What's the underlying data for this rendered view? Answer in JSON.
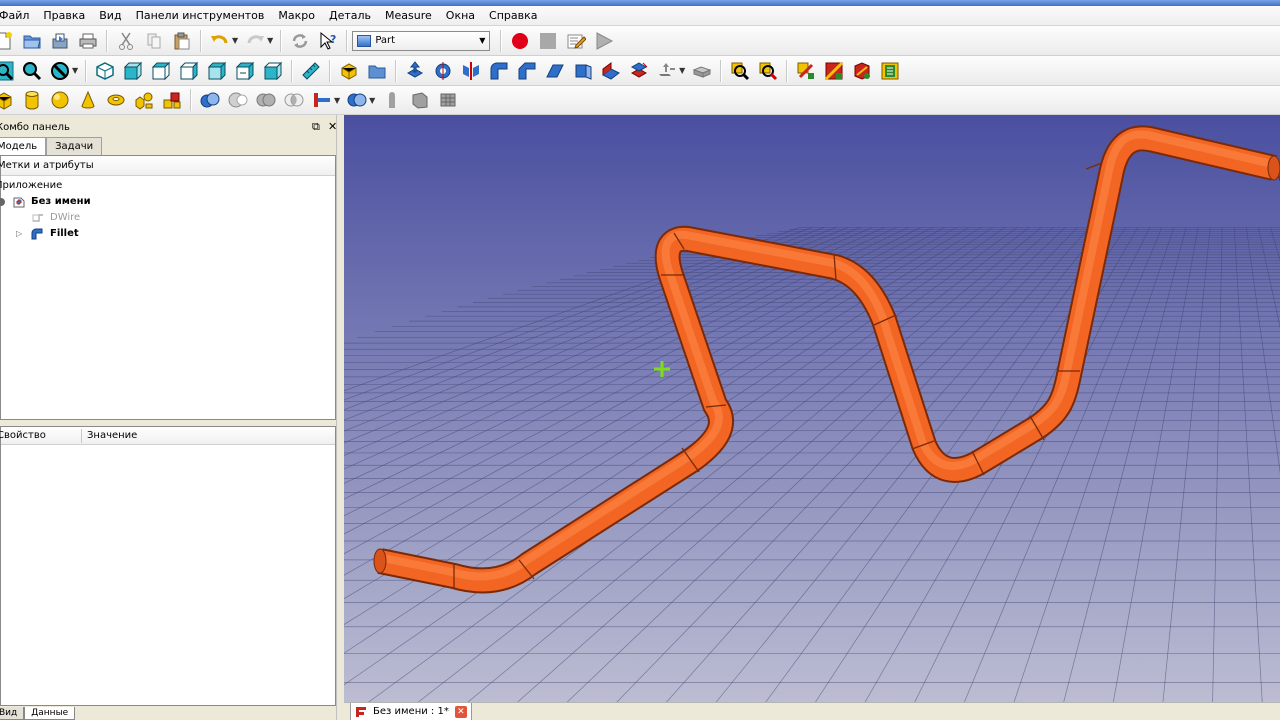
{
  "menu": [
    "Файл",
    "Правка",
    "Вид",
    "Панели инструментов",
    "Макро",
    "Деталь",
    "Measure",
    "Окна",
    "Справка"
  ],
  "workbench": {
    "selected": "Part",
    "icon": "part-cube-icon"
  },
  "combo": {
    "title": "Комбо панель",
    "tabs": [
      "Модель",
      "Задачи"
    ],
    "tree_header": "Метки и атрибуты",
    "tree": {
      "root": "Приложение",
      "document": "Без имени",
      "items": [
        {
          "label": "DWire",
          "greyed": true,
          "icon": "wire-icon"
        },
        {
          "label": "Fillet",
          "greyed": false,
          "icon": "fillet-icon"
        }
      ]
    },
    "props_columns": [
      "Свойство",
      "Значение"
    ],
    "bottom_tabs": [
      "Вид",
      "Данные"
    ]
  },
  "document_tab": {
    "label": "Без имени : 1*",
    "icon": "freecad-icon",
    "close_icon": "close-icon"
  },
  "colors": {
    "bg_top": "#4a4fa0",
    "bg_bottom": "#bcbdd2",
    "pipe": "#f26522",
    "pipe_edge": "#7a2a08",
    "grid": "#3e4170",
    "cursor": "#7fdc1a"
  },
  "toolbars": {
    "row1": [
      "new-icon",
      "open-icon",
      "save-icon",
      "print-icon",
      "cut-icon",
      "copy-icon",
      "paste-icon",
      "undo-icon",
      "redo-icon",
      "refresh-icon",
      "whats-this-icon",
      "workbench-selector",
      "macro-record-icon",
      "macro-stop-icon",
      "macro-edit-icon",
      "macro-run-icon"
    ],
    "row2": [
      "fit-all-icon",
      "fit-selection-icon",
      "draw-style-icon",
      "isometric-view-icon",
      "front-view-icon",
      "top-view-icon",
      "right-view-icon",
      "rear-view-icon",
      "bottom-view-icon",
      "left-view-icon",
      "measure-distance-icon",
      "part-icon",
      "group-icon",
      "extrude-icon",
      "revolve-icon",
      "mirror-icon",
      "fillet-icon",
      "chamfer-icon",
      "ruled-surface-icon",
      "loft-icon",
      "sweep-icon",
      "section-icon",
      "offset-icon",
      "thickness-icon",
      "check-geometry-icon",
      "defeaturing-icon",
      "measure-linear-icon",
      "measure-angular-icon",
      "measure-refresh-icon",
      "measure-toggle-icon"
    ],
    "row3": [
      "box-icon",
      "cylinder-icon",
      "sphere-icon",
      "cone-icon",
      "torus-icon",
      "primitives-icon",
      "shape-builder-icon",
      "boolean-icon",
      "cut-shape-icon",
      "fuse-icon",
      "common-icon",
      "join-icon",
      "split-icon",
      "compound-icon",
      "shape-from-mesh-icon",
      "convert-to-solid-icon",
      "reverse-shapes-icon"
    ]
  }
}
